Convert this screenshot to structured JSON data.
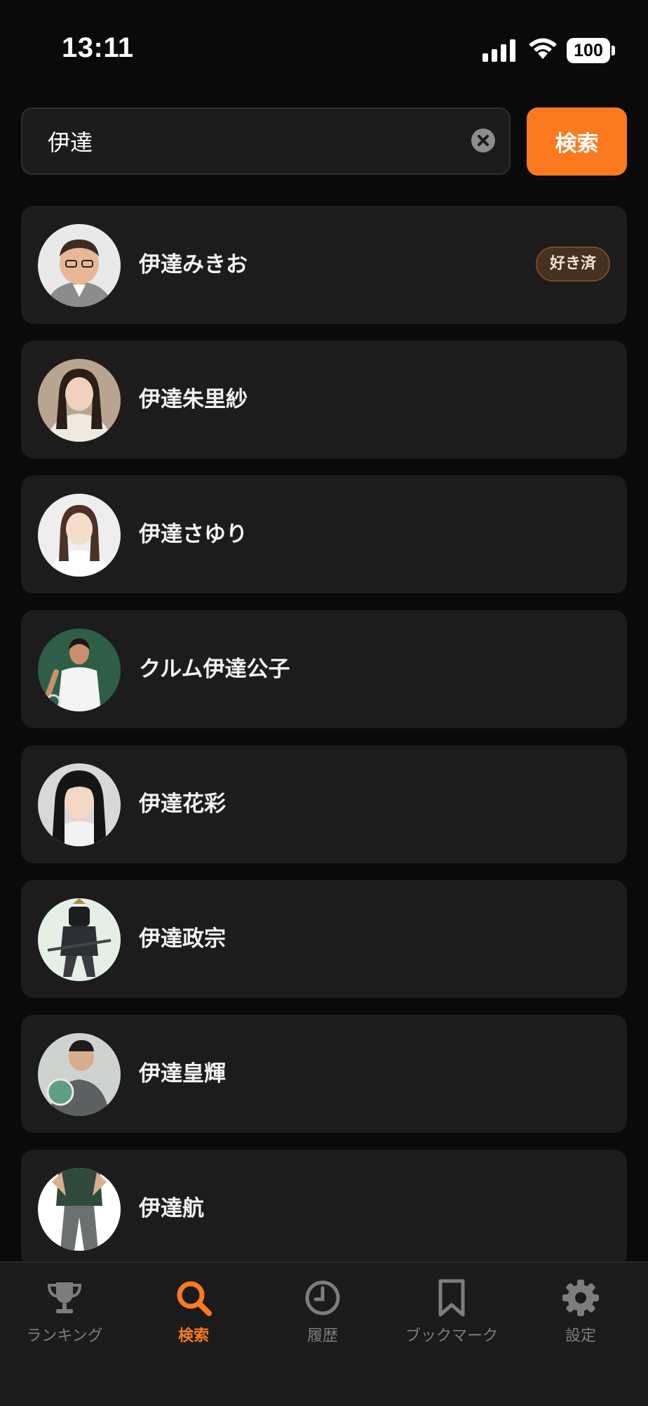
{
  "status_bar": {
    "time": "13:11",
    "battery": "100"
  },
  "search": {
    "query": "伊達",
    "button_label": "検索"
  },
  "results": [
    {
      "name": "伊達みきお",
      "badge": "好き済"
    },
    {
      "name": "伊達朱里紗"
    },
    {
      "name": "伊達さゆり"
    },
    {
      "name": "クルム伊達公子"
    },
    {
      "name": "伊達花彩"
    },
    {
      "name": "伊達政宗"
    },
    {
      "name": "伊達皇輝"
    },
    {
      "name": "伊達航"
    }
  ],
  "tab_bar": {
    "active_tab": "search",
    "tabs": [
      {
        "id": "ranking",
        "label": "ランキング",
        "icon": "trophy-icon"
      },
      {
        "id": "search",
        "label": "検索",
        "icon": "search-icon"
      },
      {
        "id": "history",
        "label": "履歴",
        "icon": "clock-icon"
      },
      {
        "id": "bookmark",
        "label": "ブックマーク",
        "icon": "bookmark-icon"
      },
      {
        "id": "settings",
        "label": "設定",
        "icon": "gear-icon"
      }
    ]
  },
  "colors": {
    "accent": "#fb7a1f",
    "background": "#0a0a0a",
    "card": "#1c1c1c",
    "inactive": "#7d7d7d"
  }
}
